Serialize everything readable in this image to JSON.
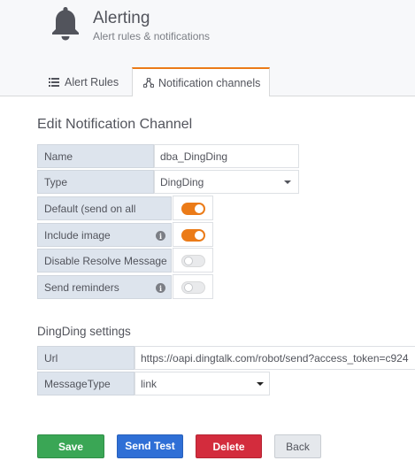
{
  "header": {
    "title": "Alerting",
    "subtitle": "Alert rules & notifications",
    "icon": "bell-icon"
  },
  "tabs": [
    {
      "label": "Alert Rules",
      "icon": "list-icon",
      "active": false
    },
    {
      "label": "Notification channels",
      "icon": "share-icon",
      "active": true
    }
  ],
  "form": {
    "title": "Edit Notification Channel",
    "name_label": "Name",
    "name_value": "dba_DingDing",
    "type_label": "Type",
    "type_value": "DingDing",
    "default_label": "Default (send on all",
    "default_on": true,
    "include_image_label": "Include image",
    "include_image_on": true,
    "disable_resolve_label": "Disable Resolve Message",
    "disable_resolve_on": false,
    "send_reminders_label": "Send reminders",
    "send_reminders_on": false
  },
  "dingding": {
    "title": "DingDing settings",
    "url_label": "Url",
    "url_value": "https://oapi.dingtalk.com/robot/send?access_token=c924",
    "message_type_label": "MessageType",
    "message_type_value": "link"
  },
  "buttons": {
    "save": "Save",
    "test": "Send Test",
    "delete": "Delete",
    "back": "Back"
  },
  "colors": {
    "accent": "#eb7b18",
    "save": "#3aa655",
    "test": "#2f6fd6",
    "delete": "#d32c3d"
  }
}
